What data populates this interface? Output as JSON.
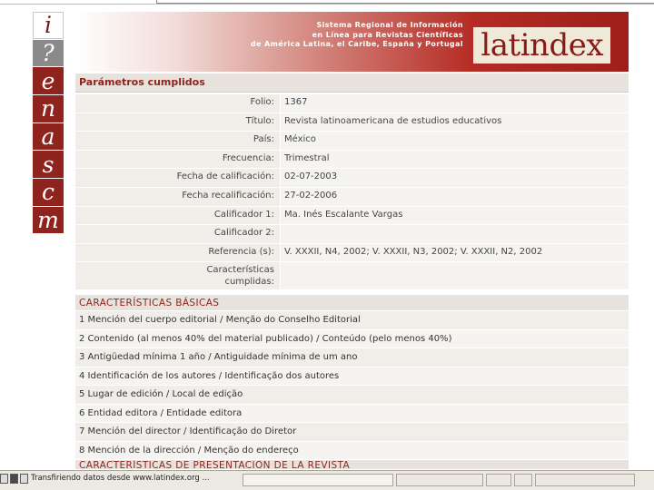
{
  "tiles": [
    "i",
    "?",
    "e",
    "n",
    "a",
    "s",
    "c",
    "m"
  ],
  "banner": {
    "tagline_lines": [
      "Sistema Regional de Información",
      "en Línea para Revistas Científicas",
      "de América Latina, el Caribe, España y Portugal"
    ],
    "logo": "latindex"
  },
  "section_title": "Parámetros cumplidos",
  "params": [
    {
      "label": "Folio:",
      "value": "1367"
    },
    {
      "label": "Título:",
      "value": "Revista latinoamericana de estudios educativos"
    },
    {
      "label": "País:",
      "value": "México"
    },
    {
      "label": "Frecuencia:",
      "value": "Trimestral"
    },
    {
      "label": "Fecha de calificación:",
      "value": "02-07-2003"
    },
    {
      "label": "Fecha recalificación:",
      "value": "27-02-2006"
    },
    {
      "label": "Calificador 1:",
      "value": "Ma. Inés Escalante Vargas"
    },
    {
      "label": "Calificador 2:",
      "value": ""
    },
    {
      "label": "Referencia (s):",
      "value": "V. XXXII, N4, 2002; V. XXXII, N3, 2002; V. XXXII, N2, 2002"
    },
    {
      "label_lines": [
        "Características",
        "cumplidas:"
      ],
      "value": ""
    }
  ],
  "characteristics": {
    "heading": "CARACTERÍSTICAS BÁSICAS",
    "items": [
      "1 Mención del cuerpo editorial / Menção do Conselho Editorial",
      "2 Contenido (al menos 40% del material publicado) / Conteúdo (pelo menos 40%)",
      "3 Antigüedad mínima 1 año / Antiguidade mínima de um ano",
      "4 Identificación de los autores / Identificação dos autores",
      "5 Lugar de edición / Local de edição",
      "6 Entidad editora / Entidade editora",
      "7 Mención del director / Identificação do Diretor",
      "8 Mención de la dirección / Menção do endereço"
    ],
    "next_heading": "CARACTERÍSTICAS DE PRESENTACIÓN DE LA REVISTA"
  },
  "statusbar": {
    "text": "Transfiriendo datos desde www.latindex.org ..."
  }
}
